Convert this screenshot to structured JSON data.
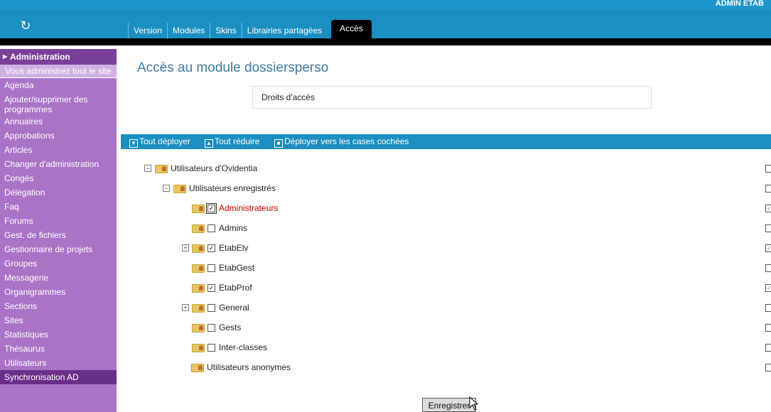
{
  "header": {
    "user_label": "ADMIN ETAB",
    "refresh_icon": "refresh-icon",
    "tabs": [
      {
        "label": "Version"
      },
      {
        "label": "Modules"
      },
      {
        "label": "Skins"
      },
      {
        "label": "Librairies partagées"
      },
      {
        "label": "Accès",
        "active": true
      }
    ]
  },
  "sidebar": {
    "title": "Administration",
    "note": "Vous administrez tout le site",
    "items": [
      {
        "label": "Agenda"
      },
      {
        "label": "Ajouter/supprimer des programmes"
      },
      {
        "label": "Annuaires"
      },
      {
        "label": "Approbations"
      },
      {
        "label": "Articles"
      },
      {
        "label": "Changer d'administration"
      },
      {
        "label": "Congés"
      },
      {
        "label": "Délégation"
      },
      {
        "label": "Faq"
      },
      {
        "label": "Forums"
      },
      {
        "label": "Gest. de fichiers"
      },
      {
        "label": "Gestionnaire de projets"
      },
      {
        "label": "Groupes"
      },
      {
        "label": "Messagerie"
      },
      {
        "label": "Organigrammes"
      },
      {
        "label": "Sections"
      },
      {
        "label": "Sites"
      },
      {
        "label": "Statistiques"
      },
      {
        "label": "Thésaurus"
      },
      {
        "label": "Utilisateurs"
      },
      {
        "label": "Synchronisation AD",
        "active": true
      }
    ]
  },
  "main": {
    "title": "Accès au module dossiersperso",
    "rights_box": "Droits d'accès",
    "toolbar": {
      "expand_all": "Tout déployer",
      "collapse_all": "Tout réduire",
      "expand_checked": "Déployer vers les cases cochées"
    },
    "tree": [
      {
        "label": "Utilisateurs d'Ovidentia",
        "level": 0,
        "expander": "minus",
        "checkbox": false,
        "right_checked": false
      },
      {
        "label": "Utilisateurs enregistrés",
        "level": 1,
        "expander": "minus",
        "checkbox": false,
        "right_checked": false
      },
      {
        "label": "Administrateurs",
        "level": 2,
        "expander": "none",
        "checkbox": true,
        "checked": true,
        "highlight": true,
        "right_checked": true
      },
      {
        "label": "Admins",
        "level": 2,
        "expander": "none",
        "checkbox": true,
        "checked": false,
        "right_checked": false
      },
      {
        "label": "EtabElv",
        "level": 2,
        "expander": "plus",
        "checkbox": true,
        "checked": true,
        "right_checked": true
      },
      {
        "label": "EtabGest",
        "level": 2,
        "expander": "none",
        "checkbox": true,
        "checked": false,
        "right_checked": false
      },
      {
        "label": "EtabProf",
        "level": 2,
        "expander": "none",
        "checkbox": true,
        "checked": true,
        "right_checked": true
      },
      {
        "label": "General",
        "level": 2,
        "expander": "plus",
        "checkbox": true,
        "checked": false,
        "right_checked": false
      },
      {
        "label": "Gests",
        "level": 2,
        "expander": "none",
        "checkbox": true,
        "checked": false,
        "right_checked": false
      },
      {
        "label": "Inter-classes",
        "level": 2,
        "expander": "none",
        "checkbox": true,
        "checked": false,
        "right_checked": false
      },
      {
        "label": "Utilisateurs anonymes",
        "level": 1,
        "expander": "none",
        "checkbox": false,
        "right_checked": false
      }
    ],
    "save_label": "Enregistrer"
  },
  "colors": {
    "header_blue": "#1b8ec2",
    "sidebar_purple": "#a974c8",
    "sidebar_header": "#7a3f9a",
    "title_blue": "#3e7aa6",
    "highlight_red": "#cc0000"
  }
}
